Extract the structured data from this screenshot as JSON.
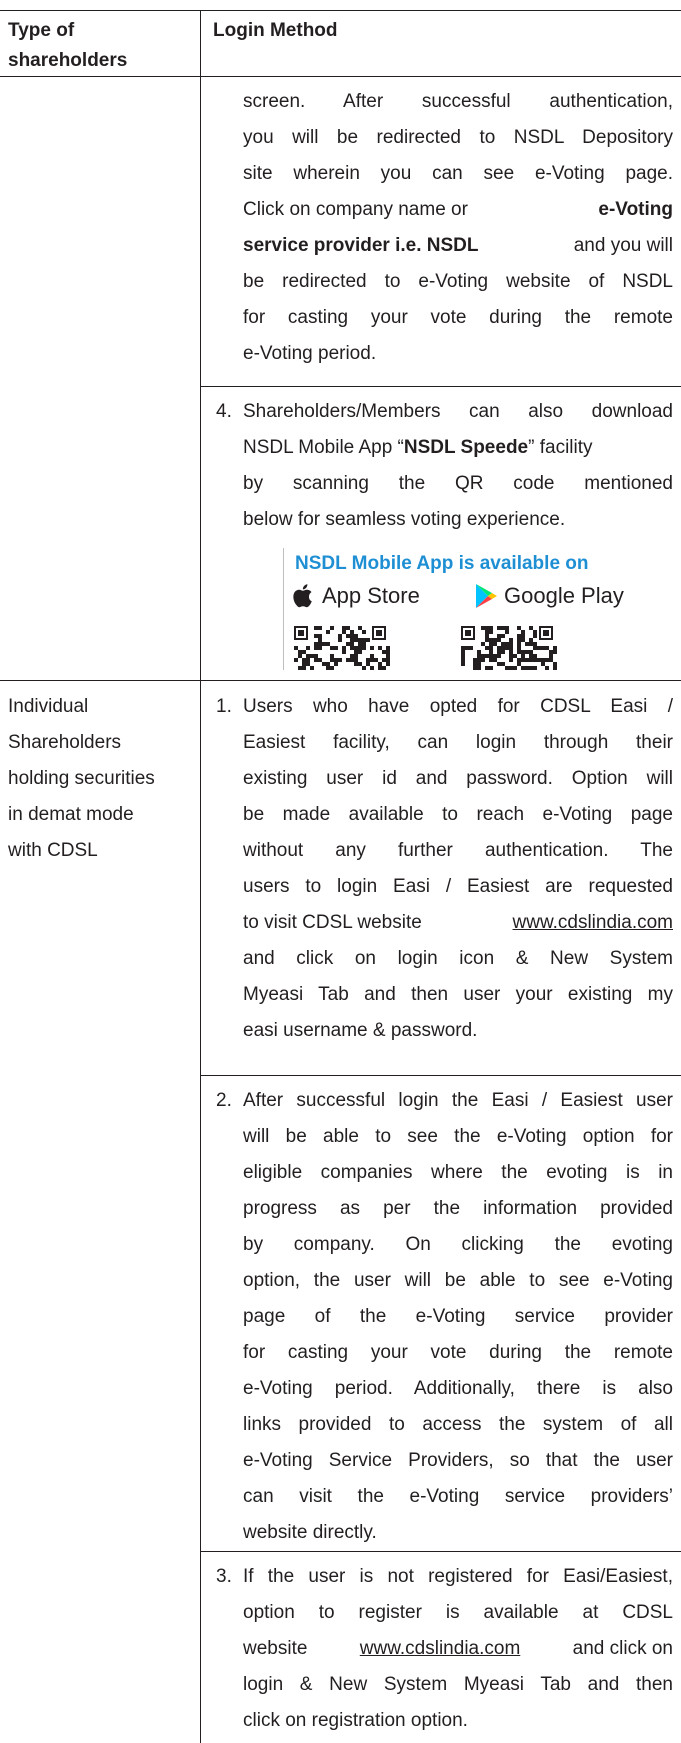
{
  "header": {
    "col1_line1": "Type of",
    "col1_line2": "shareholders",
    "col2": "Login Method"
  },
  "row_nsdl_cont": {
    "lines": [
      "screen. After successful authentication,",
      "you will be redirected to NSDL Depository",
      "site wherein you can see e-Voting page.",
      "Click on company name or",
      "service provider i.e. NSDL",
      "be redirected to e-Voting website of NSDL",
      "for casting your vote during the remote",
      "e-Voting period."
    ],
    "bold1": "e-Voting",
    "tail5": " and you will"
  },
  "row_nsdl_app": {
    "num": "4.",
    "l1": "Shareholders/Members can also download",
    "l2a": "NSDL Mobile App “",
    "l2b": "NSDL Speede",
    "l2c": "” facility",
    "l3": "by scanning the QR code mentioned",
    "l4": "below for seamless voting experience.",
    "app_title": "NSDL Mobile App is available on",
    "app_store": "App Store",
    "google_play": "Google Play"
  },
  "cdsl": {
    "type_lines": [
      "Individual",
      "Shareholders",
      "holding securities",
      "in demat mode",
      "with CDSL"
    ],
    "item1": {
      "num": "1.",
      "lines": [
        "Users who have opted for CDSL Easi /",
        "Easiest facility, can login through their",
        "existing user id and password. Option will",
        "be made available to reach e-Voting page",
        "without any further authentication. The",
        "users to login Easi / Easiest are requested",
        "to visit CDSL website",
        "and click on login icon & New System",
        "Myeasi Tab and then user your existing my",
        "easi username & password."
      ],
      "link": "www.cdslindia.com"
    },
    "item2": {
      "num": "2.",
      "lines": [
        "After successful login the Easi / Easiest user",
        "will be able to see the e-Voting option for",
        "eligible companies where the evoting is in",
        "progress as per the information provided",
        "by company. On clicking the evoting",
        "option, the user will be able to see e-Voting",
        "page of the e-Voting service provider",
        "for casting your vote during the remote",
        "e-Voting period. Additionally, there is also",
        "links provided to access the system of all",
        "e-Voting Service Providers, so that the user",
        "can visit the e-Voting service providers’",
        "website directly."
      ]
    },
    "item3": {
      "num": "3.",
      "lines": [
        "If the user is not registered for Easi/Easiest,",
        "option to register is available at CDSL",
        "website",
        "and click on",
        "login & New System Myeasi Tab and then",
        "click on registration option."
      ],
      "link": "www.cdslindia.com"
    }
  }
}
